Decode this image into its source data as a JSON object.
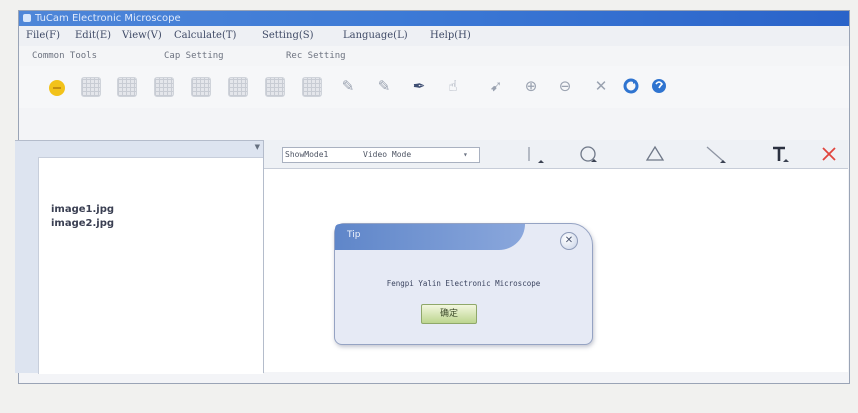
{
  "window": {
    "title": "TuCam Electronic Microscope"
  },
  "menu": [
    "File(F)",
    "Edit(E)",
    "View(V)",
    "Calculate(T)",
    "Setting(S)",
    "Language(L)",
    "Help(H)"
  ],
  "tabs": [
    "Common Tools",
    "Cap Setting",
    "Rec Setting"
  ],
  "toolbar_icons": [
    "open-folder-icon",
    "image-icon",
    "image-icon",
    "image-icon",
    "image-icon",
    "image-icon",
    "image-icon",
    "image-icon",
    "pen-icon",
    "pen-icon",
    "pen-icon",
    "hand-icon",
    "pointer-icon",
    "zoom-in-icon",
    "zoom-out-icon",
    "close-icon",
    "refresh-icon",
    "help-icon"
  ],
  "mode_select": {
    "label": "ShowMode1",
    "value": "Video Mode"
  },
  "draw_tools": [
    "line-tool-icon",
    "circle-tool-icon",
    "triangle-tool-icon",
    "pen-tool-icon",
    "text-tool-icon",
    "delete-tool-icon"
  ],
  "files": [
    "image1.jpg",
    "image2.jpg"
  ],
  "dialog": {
    "title": "Tip",
    "message": "Fengpi Yalin Electronic Microscope",
    "ok_label": "确定"
  },
  "colors": {
    "titlebar": "#3d7ad6",
    "accent_open": "#f2c21a",
    "accent_blue": "#2f74d0",
    "delete_red": "#e0453e",
    "ok_green": "#bcd58f"
  }
}
